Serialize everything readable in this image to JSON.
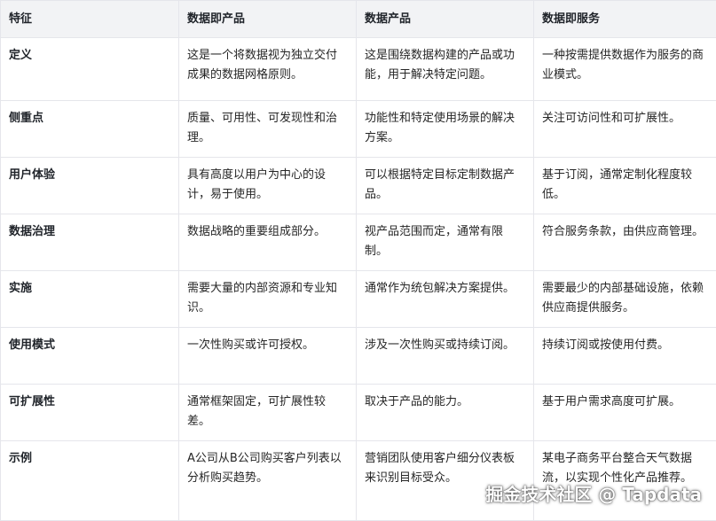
{
  "header": [
    "特征",
    "数据即产品",
    "数据产品",
    "数据即服务"
  ],
  "rows": [
    [
      "定义",
      "这是一个将数据视为独立交付成果的数据网格原则。",
      "这是围绕数据构建的产品或功能，用于解决特定问题。",
      "一种按需提供数据作为服务的商业模式。"
    ],
    [
      "侧重点",
      "质量、可用性、可发现性和治理。",
      "功能性和特定使用场景的解决方案。",
      "关注可访问性和可扩展性。"
    ],
    [
      "用户体验",
      "具有高度以用户为中心的设计，易于使用。",
      "可以根据特定目标定制数据产品。",
      "基于订阅，通常定制化程度较低。"
    ],
    [
      "数据治理",
      "数据战略的重要组成部分。",
      "视产品范围而定，通常有限制。",
      "符合服务条款，由供应商管理。"
    ],
    [
      "实施",
      "需要大量的内部资源和专业知识。",
      "通常作为统包解决方案提供。",
      "需要最少的内部基础设施，依赖供应商提供服务。"
    ],
    [
      "使用模式",
      "一次性购买或许可授权。",
      "涉及一次性购买或持续订阅。",
      "持续订阅或按使用付费。"
    ],
    [
      "可扩展性",
      "通常框架固定，可扩展性较差。",
      "取决于产品的能力。",
      "基于用户需求高度可扩展。"
    ],
    [
      "示例",
      "A公司从B公司购买客户列表以分析购买趋势。",
      "营销团队使用客户细分仪表板来识别目标受众。",
      "某电子商务平台整合天气数据流，以实现个性化产品推荐。"
    ]
  ],
  "watermark": "掘金技术社区 @ Tapdata"
}
